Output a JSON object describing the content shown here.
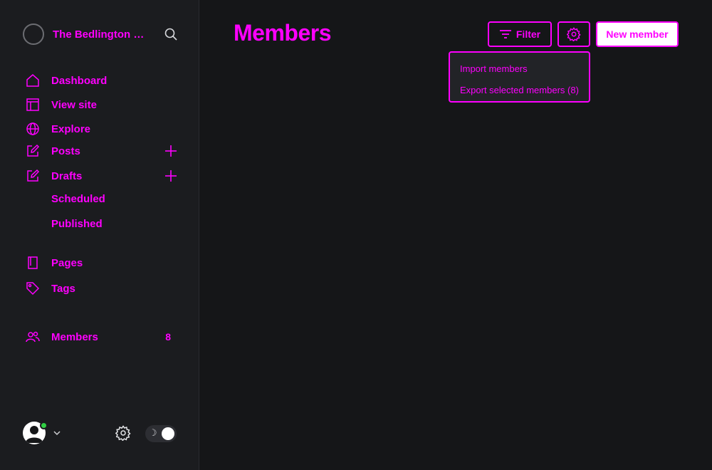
{
  "sidebar": {
    "site_title": "The Bedlington Bo...",
    "nav": [
      {
        "label": "Dashboard",
        "icon": "home-icon"
      },
      {
        "label": "View site",
        "icon": "browser-icon"
      },
      {
        "label": "Explore",
        "icon": "globe-icon"
      },
      {
        "label": "Posts",
        "icon": "pencil-square-icon"
      },
      {
        "label": "Drafts",
        "icon": "pencil-square-icon"
      }
    ],
    "post_subitems": [
      "Scheduled",
      "Published"
    ],
    "pages_label": "Pages",
    "tags_label": "Tags",
    "members_label": "Members",
    "members_count": "8"
  },
  "footer": {
    "theme_icon": "moon-icon"
  },
  "main": {
    "title": "Members",
    "filter_label": "Filter",
    "new_member_label": "New member",
    "menu": {
      "import": "Import members",
      "export": "Export selected members (8)"
    }
  },
  "colors": {
    "accent": "#ff00ff",
    "background": "#151618",
    "sidebar": "#1b1c1f",
    "online": "#30cf43"
  }
}
